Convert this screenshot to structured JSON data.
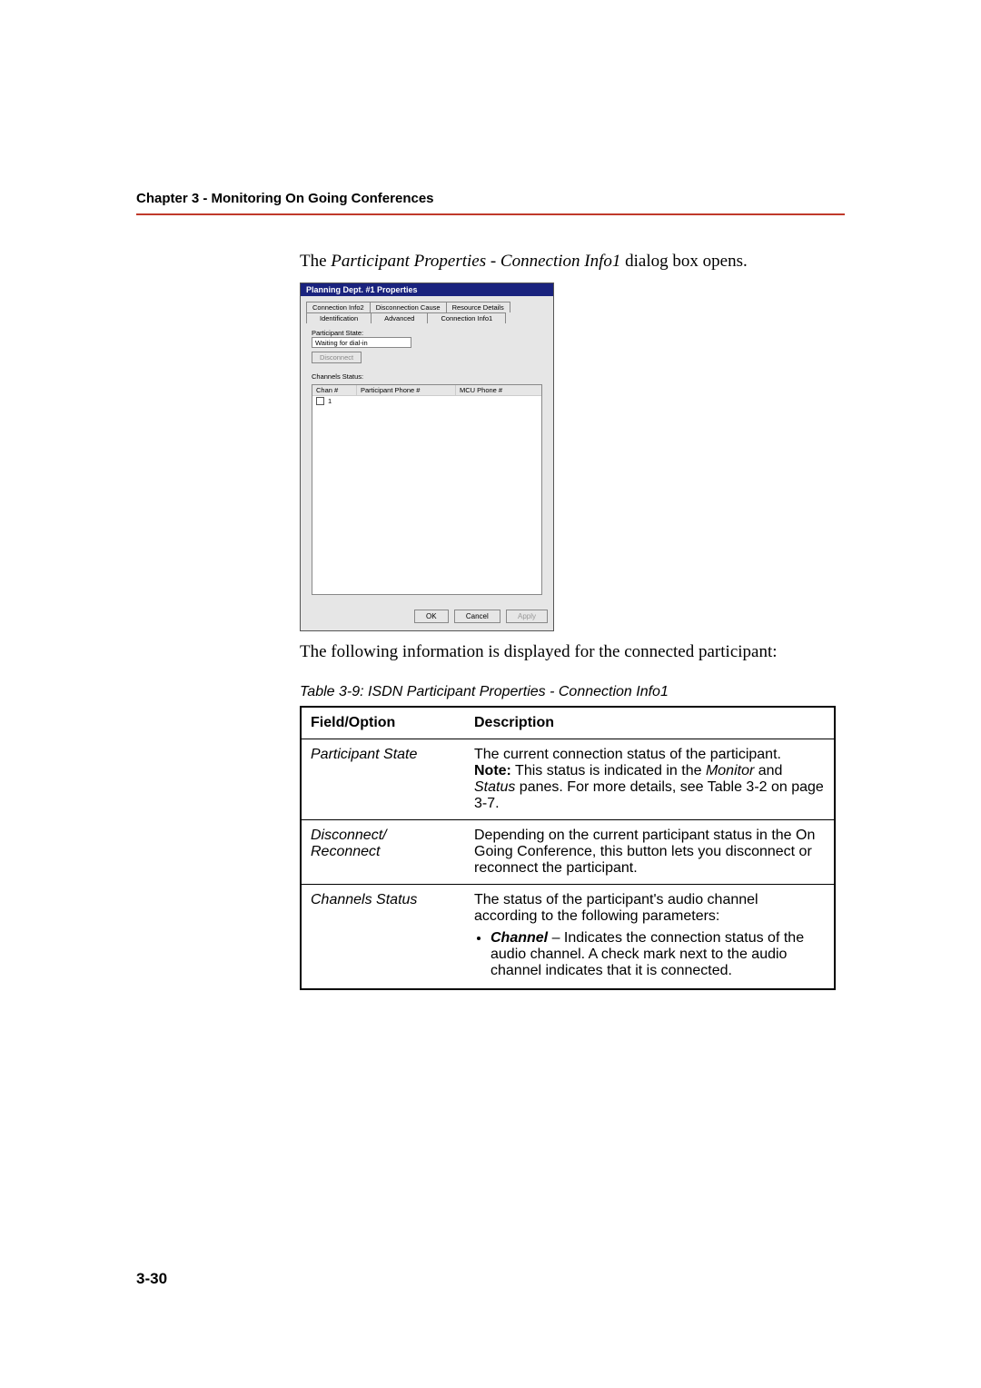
{
  "header": {
    "chapter": "Chapter 3 - Monitoring On Going Conferences"
  },
  "intro": {
    "pre": "The ",
    "dialog_name": "Participant Properties - Connection Info1",
    "post": " dialog box opens."
  },
  "dialog": {
    "title": "Planning Dept. #1 Properties",
    "tabs_row1": [
      "Connection Info2",
      "Disconnection Cause",
      "Resource Details"
    ],
    "tabs_row2": [
      "Identification",
      "Advanced",
      "Connection Info1"
    ],
    "participant_state_label": "Participant State:",
    "participant_state_value": "Waiting for dial-in",
    "disconnect_btn": "Disconnect",
    "channels_status_label": "Channels Status:",
    "ch_head": {
      "c1": "Chan #",
      "c2": "Participant Phone #",
      "c3": "MCU Phone #"
    },
    "ch_row_value": "1",
    "buttons": {
      "ok": "OK",
      "cancel": "Cancel",
      "apply": "Apply"
    }
  },
  "after_shot": "The following information is displayed for the connected participant:",
  "table_caption": "Table 3-9: ISDN Participant Properties - Connection Info1",
  "table": {
    "head": {
      "field": "Field/Option",
      "desc": "Description"
    },
    "rows": [
      {
        "field": "Participant State",
        "desc_line1": "The current connection status of the participant.",
        "note_label": "Note:",
        "note_mid1": " This status is indicated in the ",
        "note_em1": "Monitor",
        "note_mid2": " and ",
        "note_em2": "Status",
        "note_tail": " panes. For more details, see Table 3-2 on page 3-7."
      },
      {
        "field": "Disconnect/ Reconnect",
        "desc": "Depending on the current participant status in the On Going Conference, this button lets you disconnect or reconnect the participant."
      },
      {
        "field": "Channels Status",
        "desc_intro": "The status of the participant's audio channel according to the following parameters:",
        "bullet_strong": "Channel",
        "bullet_rest": " – Indicates the connection status of the audio channel. A check mark next to the audio channel indicates that it is connected."
      }
    ]
  },
  "page_number": "3-30"
}
